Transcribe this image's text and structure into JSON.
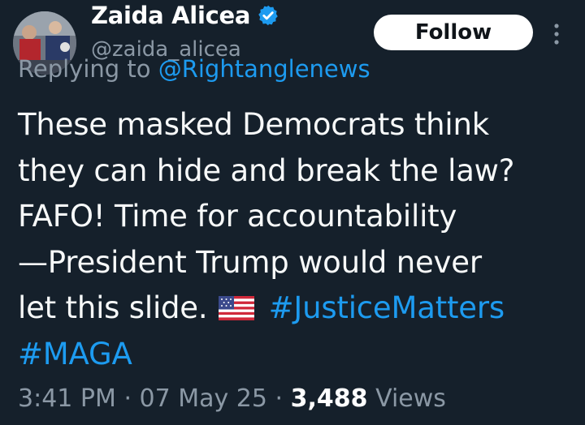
{
  "author": {
    "display_name": "Zaida Alicea",
    "handle": "@zaida_alicea",
    "verified": true,
    "avatar_icon": "profile-photo"
  },
  "follow_button": {
    "label": "Follow"
  },
  "more_icon": "vertical-ellipsis-icon",
  "reply": {
    "prefix": "Replying to",
    "mention": "@Rightanglenews"
  },
  "tweet": {
    "line1": "These masked Democrats think",
    "line2": "they can hide and break the law?",
    "line3": "FAFO! Time for accountability",
    "line4": "—President Trump would never",
    "line5_text": "let this slide.",
    "flag_emoji": "🇺🇸",
    "hashtag1": "#JusticeMatters",
    "hashtag2": "#MAGA"
  },
  "meta": {
    "time": "3:41 PM",
    "separator": "·",
    "date": "07 May 25",
    "views_count": "3,488",
    "views_label": "Views"
  },
  "colors": {
    "background": "#15202b",
    "link": "#1d9bf0",
    "muted": "#8b98a5"
  }
}
